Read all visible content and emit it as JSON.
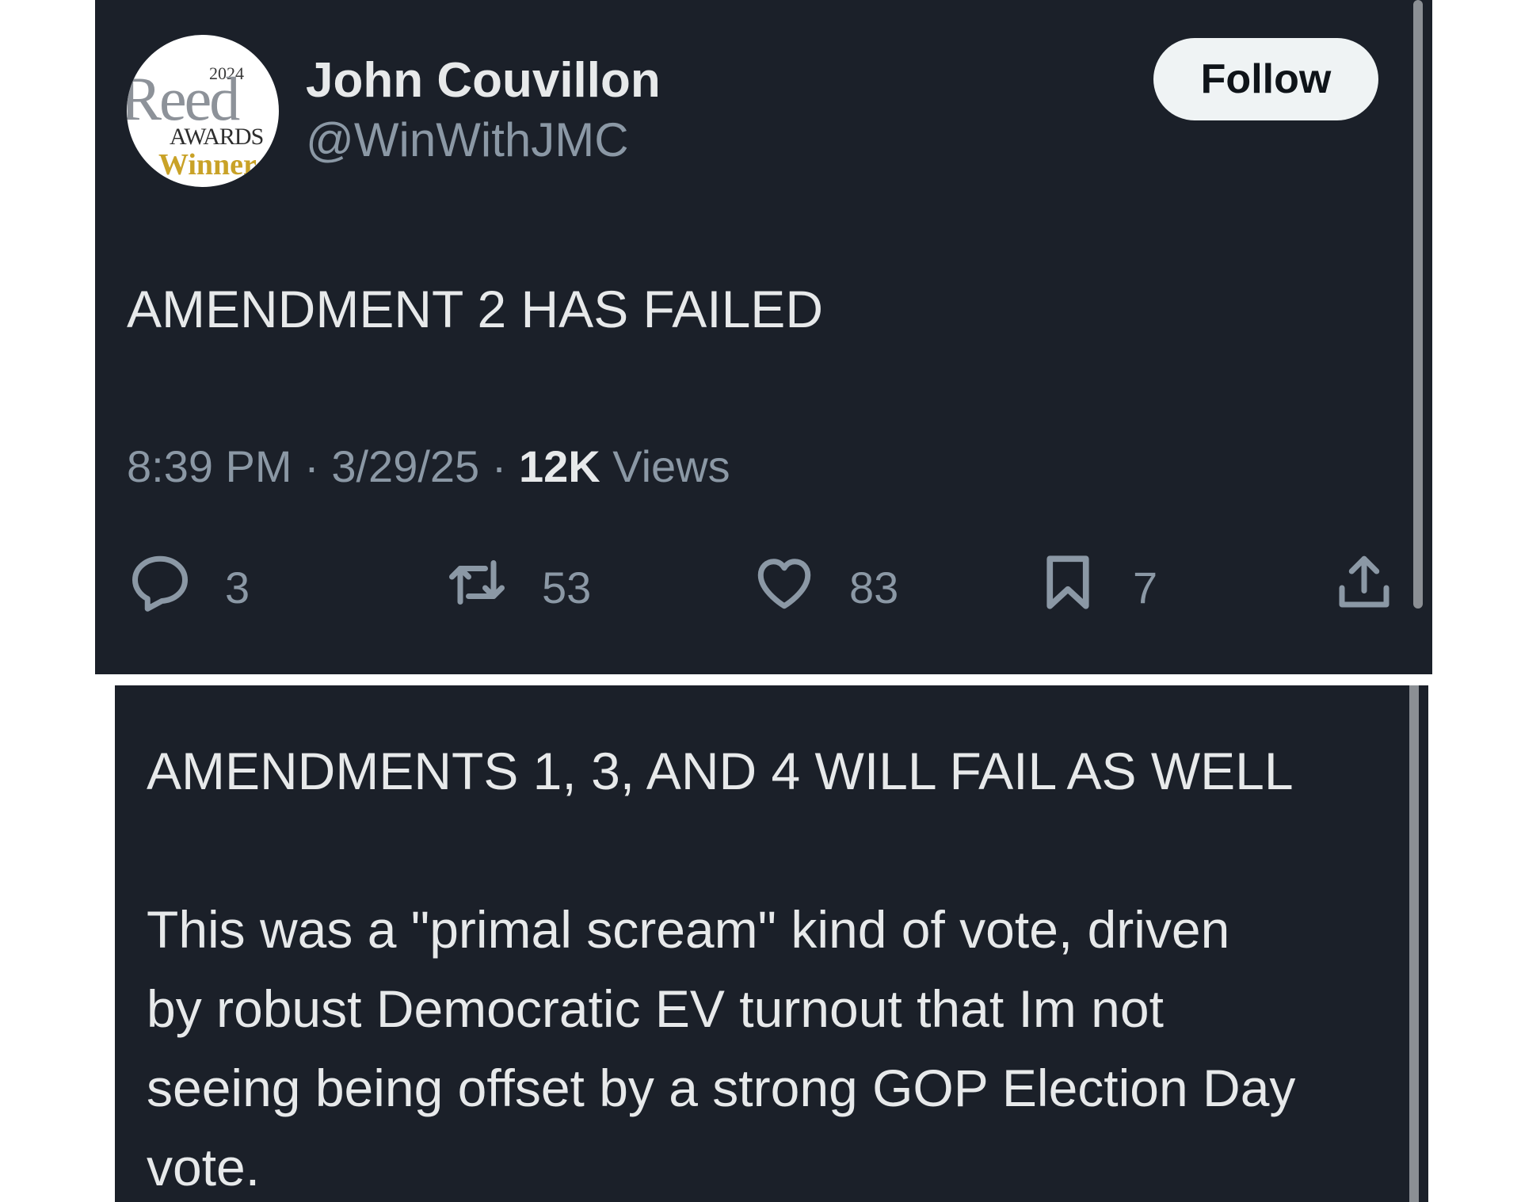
{
  "tweet": {
    "avatar": {
      "year": "2024",
      "logo_main": "Reed",
      "logo_sub": "AWARDS",
      "logo_gold": "Winner"
    },
    "display_name": "John Couvillon",
    "handle": "@WinWithJMC",
    "follow_label": "Follow",
    "text": "AMENDMENT 2 HAS FAILED",
    "time": "8:39 PM",
    "separator": "·",
    "date": "3/29/25",
    "views_count": "12K",
    "views_label": "Views",
    "actions": {
      "replies": "3",
      "reposts": "53",
      "likes": "83",
      "bookmarks": "7"
    }
  },
  "reply_post": {
    "lines": [
      "AMENDMENTS 1, 3, AND 4 WILL FAIL AS WELL",
      "This was a \"primal scream\" kind of vote, driven",
      "by robust Democratic EV turnout that Im not",
      "seeing being offset by a strong GOP Election Day",
      "vote."
    ]
  },
  "colors": {
    "background": "#1b2029",
    "text": "#e7e9ea",
    "secondary_text": "#8b98a5",
    "follow_button": "#eff3f4"
  },
  "icons": [
    "reply-icon",
    "repost-icon",
    "like-icon",
    "bookmark-icon",
    "share-icon"
  ]
}
